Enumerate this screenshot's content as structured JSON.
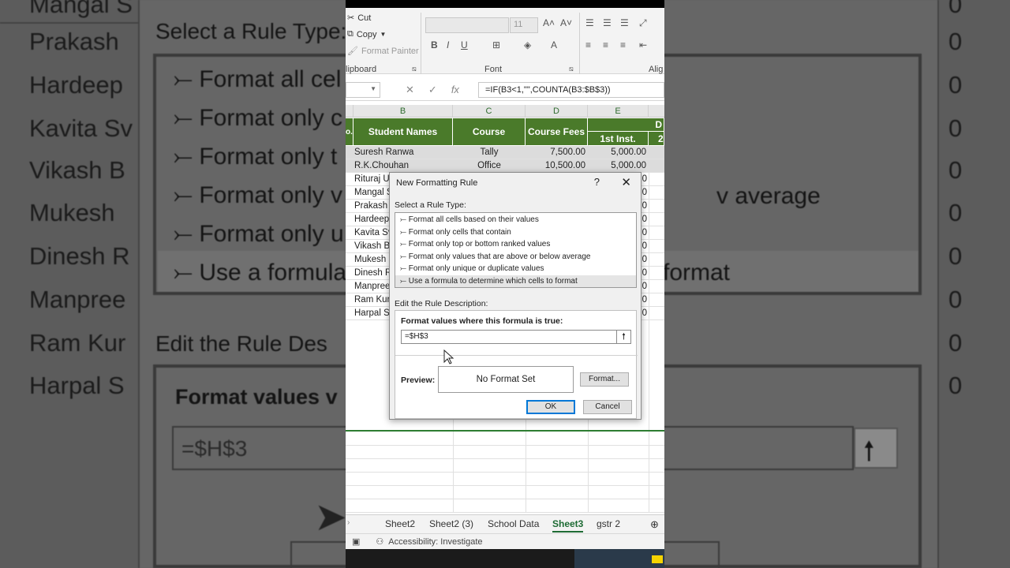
{
  "ribbon": {
    "cut": "Cut",
    "copy": "Copy",
    "format_painter": "Format Painter",
    "clipboard_label": "lipboard",
    "font_label": "Font",
    "alignment_label": "Alig",
    "font_size": "11"
  },
  "formula_bar": {
    "formula": "=IF(B3<1,\"\",COUNTA(B3:$B$3))"
  },
  "columns": [
    "B",
    "C",
    "D",
    "E"
  ],
  "table": {
    "header_a": "o.",
    "header_b": "Student Names",
    "header_c": "Course",
    "header_d": "Course Fees",
    "header_e_top": "D",
    "header_e": "1st Inst.",
    "header_f": "2",
    "rows": [
      {
        "name": "Suresh Ranwa",
        "course": "Tally",
        "fees": "7,500.00",
        "inst": "5,000.00"
      },
      {
        "name": "R.K.Chouhan",
        "course": "Office",
        "fees": "10,500.00",
        "inst": "5,000.00"
      },
      {
        "name": "Rituraj U",
        "inst": "0"
      },
      {
        "name": "Mangal S",
        "inst": "0"
      },
      {
        "name": "Prakash",
        "inst": "0"
      },
      {
        "name": "Hardeep",
        "inst": "0"
      },
      {
        "name": "Kavita Sv",
        "inst": "0"
      },
      {
        "name": "Vikash B",
        "inst": "0"
      },
      {
        "name": "Mukesh",
        "inst": "0"
      },
      {
        "name": "Dinesh R",
        "inst": "0"
      },
      {
        "name": "Manpree",
        "inst": "0"
      },
      {
        "name": "Ram Kur",
        "inst": "0"
      },
      {
        "name": "Harpal S",
        "inst": "0"
      }
    ]
  },
  "dialog": {
    "title": "New Formatting Rule",
    "help": "?",
    "close": "✕",
    "select_rule_label": "Select a Rule Type:",
    "rules": [
      "Format all cells based on their values",
      "Format only cells that contain",
      "Format only top or bottom ranked values",
      "Format only values that are above or below average",
      "Format only unique or duplicate values",
      "Use a formula to determine which cells to format"
    ],
    "selected_rule_index": 5,
    "edit_desc_label": "Edit the Rule Description:",
    "formula_label": "Format values where this formula is true:",
    "formula_value": "=$H$3",
    "preview_label": "Preview:",
    "preview_text": "No Format Set",
    "format_button": "Format...",
    "ok_button": "OK",
    "cancel_button": "Cancel"
  },
  "sheet_tabs": [
    "Sheet2",
    "Sheet2 (3)",
    "School Data",
    "Sheet3",
    "gstr 2"
  ],
  "active_tab": "Sheet3",
  "status": {
    "accessibility": "Accessibility: Investigate"
  },
  "background_zoom": {
    "left_names": [
      "Mangal S",
      "Prakash",
      "Hardeep",
      "Kavita Sv",
      "Vikash B",
      "Mukesh",
      "Dinesh R",
      "Manpree",
      "Ram Kur",
      "Harpal S"
    ],
    "select_rule": "Select a Rule Type:",
    "rules": [
      "Format all cel",
      "Format only c",
      "Format only t",
      "Format only v",
      "Format only u",
      "Use a formula"
    ],
    "edit_desc": "Edit the Rule Des",
    "format_values": "Format values v",
    "formula": "=$H$3",
    "right_average": "v average",
    "right_format": "format",
    "right_zeros": [
      "0",
      "0",
      "0",
      "0",
      "0",
      "0",
      "0",
      "0",
      "0",
      "0"
    ]
  },
  "colors": {
    "header_green": "#4a7a2a",
    "active_tab": "#1e6b34",
    "ok_border": "#0078d7"
  }
}
